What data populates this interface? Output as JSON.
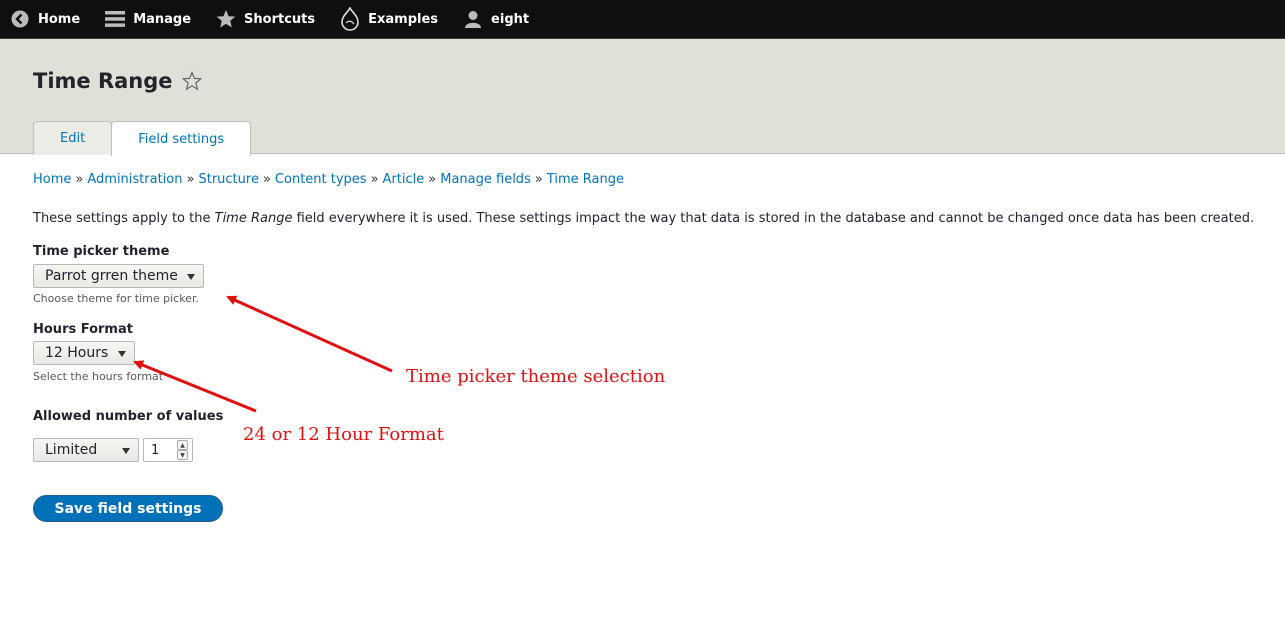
{
  "toolbar": {
    "items": [
      {
        "label": "Home",
        "icon": "back-arrow-icon"
      },
      {
        "label": "Manage",
        "icon": "menu-icon"
      },
      {
        "label": "Shortcuts",
        "icon": "star-icon"
      },
      {
        "label": "Examples",
        "icon": "drupal-drop-icon"
      },
      {
        "label": "eight",
        "icon": "user-icon"
      }
    ]
  },
  "page": {
    "title": "Time Range",
    "tabs": [
      {
        "label": "Edit",
        "active": false
      },
      {
        "label": "Field settings",
        "active": true
      }
    ]
  },
  "breadcrumb": {
    "items": [
      "Home",
      "Administration",
      "Structure",
      "Content types",
      "Article",
      "Manage fields",
      "Time Range"
    ],
    "separator": "»"
  },
  "description": {
    "before": "These settings apply to the ",
    "em": "Time Range",
    "after": " field everywhere it is used. These settings impact the way that data is stored in the database and cannot be changed once data has been created."
  },
  "form": {
    "theme": {
      "label": "Time picker theme",
      "value": "Parrot grren theme",
      "help": "Choose theme for time picker."
    },
    "hours": {
      "label": "Hours Format",
      "value": "12 Hours",
      "help": "Select the hours format"
    },
    "allowed": {
      "label": "Allowed number of values",
      "value": "Limited",
      "count": "1"
    },
    "save_label": "Save field settings"
  },
  "annotations": {
    "theme": "Time picker theme selection",
    "hours": "24 or 12 Hour Format",
    "color": "#e01010"
  },
  "colors": {
    "toolbar": "#0f0f0f",
    "header": "#e0e0d8",
    "link": "#0074bd",
    "primary_button": "#0071b8"
  }
}
